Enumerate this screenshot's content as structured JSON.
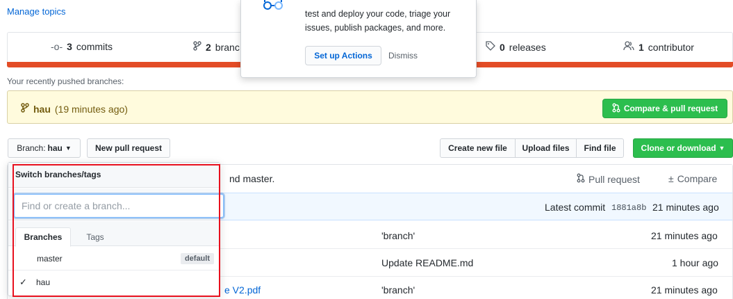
{
  "manage_topics": "Manage topics",
  "stats": {
    "commits_count": "3",
    "commits_label": "commits",
    "branches_count": "2",
    "branches_label": "branc",
    "releases_count": "0",
    "releases_label": "releases",
    "contributors_count": "1",
    "contributors_label": "contributor"
  },
  "popover": {
    "text": "test and deploy your code, triage your issues, publish packages, and more.",
    "setup_label": "Set up Actions",
    "dismiss_label": "Dismiss"
  },
  "recent": {
    "label": "Your recently pushed branches:",
    "branch": "hau",
    "time": "(19 minutes ago)",
    "compare_label": "Compare & pull request"
  },
  "toolbar": {
    "branch_prefix": "Branch:",
    "branch_name": "hau",
    "new_pr_label": "New pull request",
    "create_file_label": "Create new file",
    "upload_label": "Upload files",
    "find_file_label": "Find file",
    "clone_label": "Clone or download"
  },
  "compare_row": {
    "text": "nd master.",
    "pull_request_label": "Pull request",
    "compare_label": "Compare"
  },
  "latest_commit": {
    "label": "Latest commit",
    "sha": "1881a8b",
    "time": "21 minutes ago"
  },
  "files": [
    {
      "name": "",
      "message": "'branch'",
      "time": "21 minutes ago"
    },
    {
      "name": "",
      "message": "Update README.md",
      "time": "1 hour ago"
    },
    {
      "name": "e V2.pdf",
      "message": "'branch'",
      "time": "21 minutes ago"
    }
  ],
  "dropdown": {
    "header": "Switch branches/tags",
    "search_placeholder": "Find or create a branch...",
    "tab_branches": "Branches",
    "tab_tags": "Tags",
    "items": [
      {
        "name": "master",
        "badge": "default",
        "selected": false
      },
      {
        "name": "hau",
        "badge": "",
        "selected": true
      }
    ]
  },
  "colors": {
    "highlight": "#e8101e",
    "language_bar": "#e34c26",
    "green": "#2cbe4e",
    "link": "#0366d6"
  }
}
